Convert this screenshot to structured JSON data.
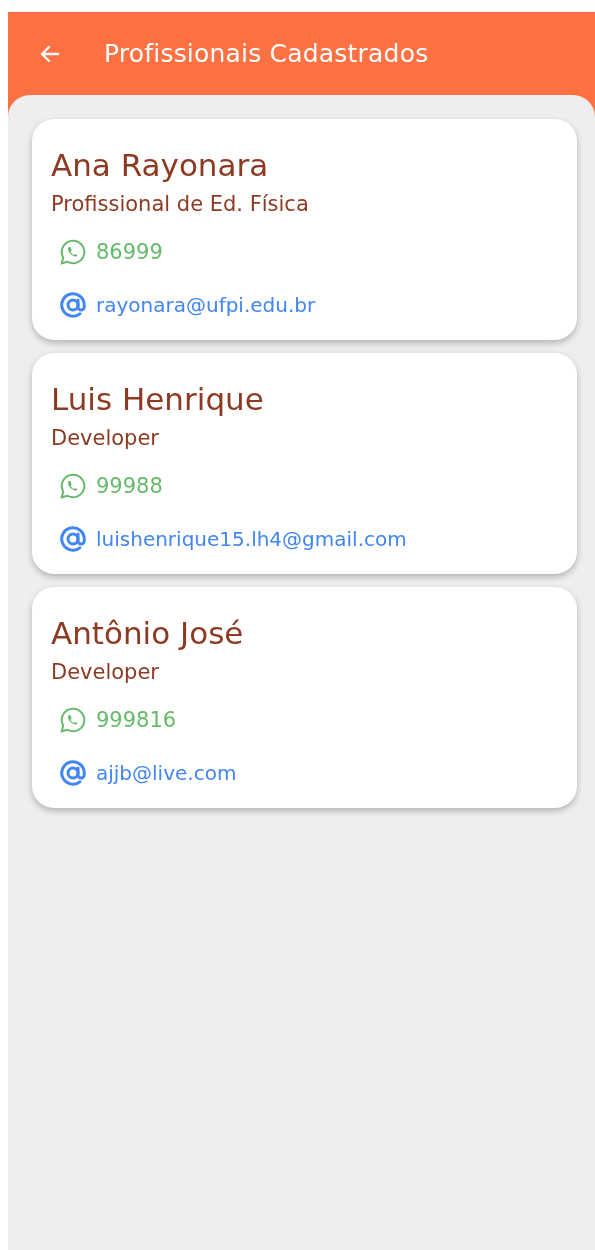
{
  "app_bar": {
    "title": "Profissionais Cadastrados"
  },
  "professionals": [
    {
      "name": "Ana Rayonara",
      "role": "Profissional de Ed. Física",
      "phone": "86999",
      "email": "rayonara@ufpi.edu.br"
    },
    {
      "name": "Luis Henrique",
      "role": "Developer",
      "phone": "99988",
      "email": "luishenrique15.lh4@gmail.com"
    },
    {
      "name": "Antônio José",
      "role": "Developer",
      "phone": "999816",
      "email": "ajjb@live.com"
    }
  ]
}
